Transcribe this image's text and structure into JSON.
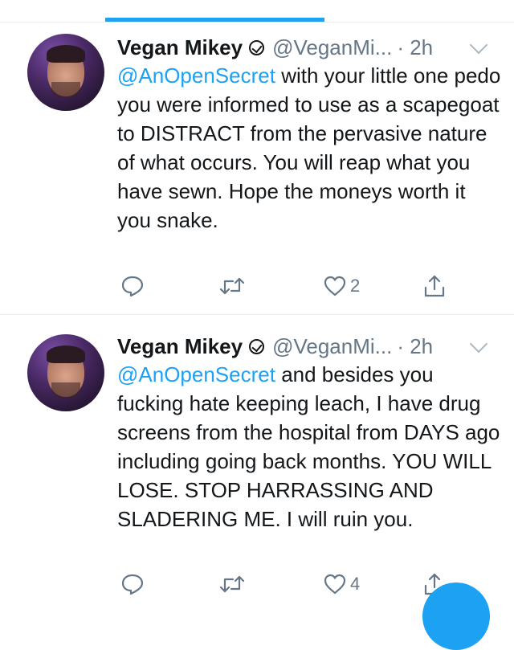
{
  "tweets": [
    {
      "name": "Vegan Mikey",
      "handle": "@VeganMi...",
      "time": "· 2h",
      "mention": "@AnOpenSecret",
      "text": "with your little one pedo you were informed to use as a scapegoat to DISTRACT from the pervasive nature of what occurs. You will reap what you have sewn. Hope the moneys worth it you snake.",
      "likes": "2"
    },
    {
      "name": "Vegan Mikey",
      "handle": "@VeganMi...",
      "time": "· 2h",
      "mention": "@AnOpenSecret",
      "text": "and besides you fucking hate keeping leach, I have drug screens from the hospital from DAYS ago including going back months. YOU WILL LOSE. STOP HARRASSING AND SLADERING ME. I will ruin you.",
      "likes": "4"
    }
  ],
  "colors": {
    "accent": "#1da1f2",
    "secondary_text": "#657786",
    "icon": "#657786",
    "divider": "#e6ecf0"
  },
  "icons": [
    "verified-icon",
    "chevron-down-icon",
    "reply-icon",
    "retweet-icon",
    "heart-icon",
    "share-icon"
  ]
}
